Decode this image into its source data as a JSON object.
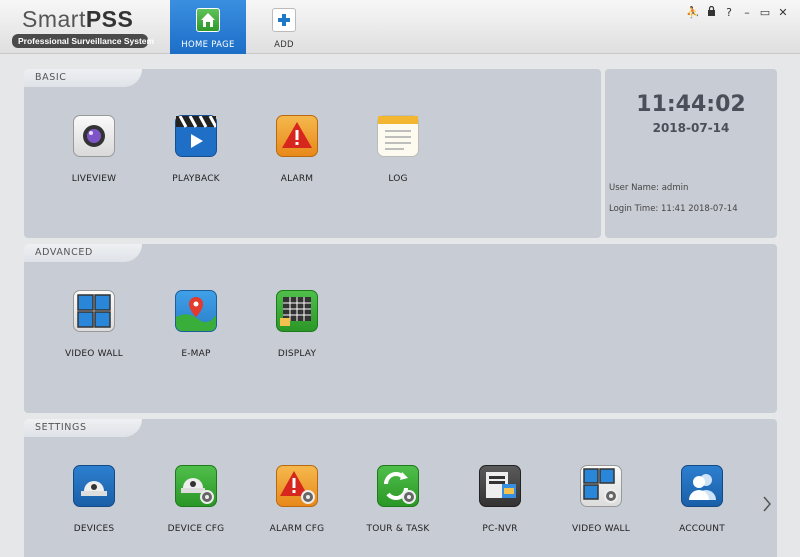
{
  "app": {
    "logo_title_plain": "Smart",
    "logo_title_bold": "PSS",
    "logo_subtitle": "Professional Surveillance System"
  },
  "tabs": [
    {
      "label": "HOME PAGE",
      "active": true
    },
    {
      "label": "ADD",
      "active": false
    }
  ],
  "window_controls": [
    "user-icon",
    "lock-icon",
    "help-icon",
    "minimize-icon",
    "maximize-icon",
    "close-icon"
  ],
  "window_glyphs": {
    "user": "⛹",
    "lock": "🔒",
    "help": "?",
    "minimize": "–",
    "maximize": "▭",
    "close": "✕"
  },
  "basic": {
    "title": "BASIC",
    "items": [
      {
        "label": "LIVEVIEW",
        "icon": "camera-icon"
      },
      {
        "label": "PLAYBACK",
        "icon": "clapperboard-icon"
      },
      {
        "label": "ALARM",
        "icon": "warning-icon"
      },
      {
        "label": "LOG",
        "icon": "notepad-icon"
      }
    ]
  },
  "advanced": {
    "title": "ADVANCED",
    "items": [
      {
        "label": "VIDEO WALL",
        "icon": "video-wall-icon"
      },
      {
        "label": "E-MAP",
        "icon": "map-pin-icon"
      },
      {
        "label": "DISPLAY",
        "icon": "display-grid-icon"
      }
    ]
  },
  "settings": {
    "title": "SETTINGS",
    "items": [
      {
        "label": "DEVICES",
        "icon": "dome-camera-icon"
      },
      {
        "label": "DEVICE CFG",
        "icon": "dome-camera-gear-icon"
      },
      {
        "label": "ALARM CFG",
        "icon": "warning-gear-icon"
      },
      {
        "label": "TOUR & TASK",
        "icon": "refresh-gear-icon"
      },
      {
        "label": "PC-NVR",
        "icon": "pc-nvr-icon"
      },
      {
        "label": "VIDEO WALL",
        "icon": "video-wall-gear-icon"
      },
      {
        "label": "ACCOUNT",
        "icon": "users-icon"
      }
    ]
  },
  "clock": {
    "time": "11:44:02",
    "date": "2018-07-14",
    "user_name": "User Name: admin",
    "login_time": "Login Time: 11:41 2018-07-14"
  },
  "colors": {
    "accent_tab": "#1c6ec7",
    "panel_bg": "#c8ccd4"
  }
}
